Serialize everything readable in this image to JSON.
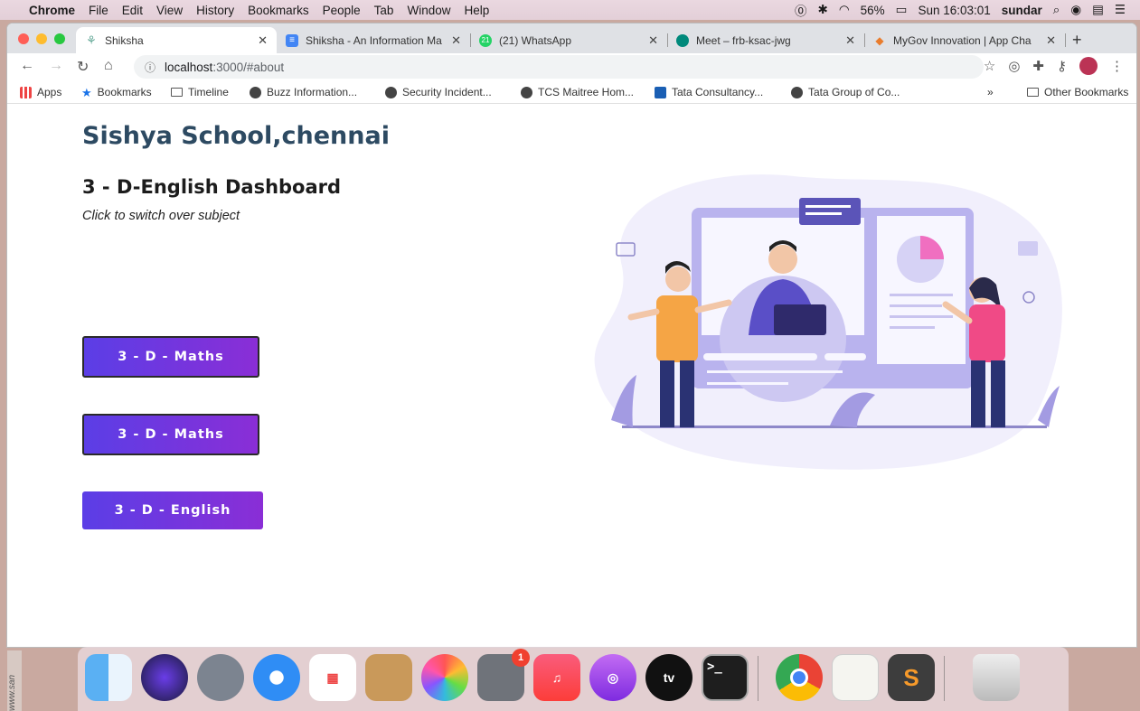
{
  "menubar": {
    "app": "Chrome",
    "items": [
      "File",
      "Edit",
      "View",
      "History",
      "Bookmarks",
      "People",
      "Tab",
      "Window",
      "Help"
    ],
    "battery": "56%",
    "clock": "Sun 16:03:01",
    "user": "sundar"
  },
  "tabs": [
    {
      "title": "Shiksha"
    },
    {
      "title": "Shiksha - An Information Ma"
    },
    {
      "title": "(21) WhatsApp"
    },
    {
      "title": "Meet – frb-ksac-jwg"
    },
    {
      "title": "MyGov Innovation | App Cha"
    }
  ],
  "address": {
    "host": "localhost",
    "path": ":3000/#about"
  },
  "bookmarks": [
    {
      "label": "Apps"
    },
    {
      "label": "Bookmarks"
    },
    {
      "label": "Timeline"
    },
    {
      "label": "Buzz Information..."
    },
    {
      "label": "Security Incident..."
    },
    {
      "label": "TCS Maitree Hom..."
    },
    {
      "label": "Tata Consultancy..."
    },
    {
      "label": "Tata Group of Co..."
    },
    {
      "label": "Other Bookmarks"
    }
  ],
  "page": {
    "school": "Sishya School,chennai",
    "dashboard": "3 - D-English Dashboard",
    "hint": "Click to switch over subject",
    "buttons": [
      "3 - D - Maths",
      "3 - D - Maths",
      "3 - D - English"
    ]
  },
  "dock": {
    "tv_label": "tv",
    "badge": "1",
    "terminal_prompt": ">_",
    "side_text": "www.san"
  },
  "colors": {
    "title": "#2d4a62",
    "button_start": "#5b3ee6",
    "button_end": "#8a2ed6",
    "illustration": "#b9b3ee"
  }
}
